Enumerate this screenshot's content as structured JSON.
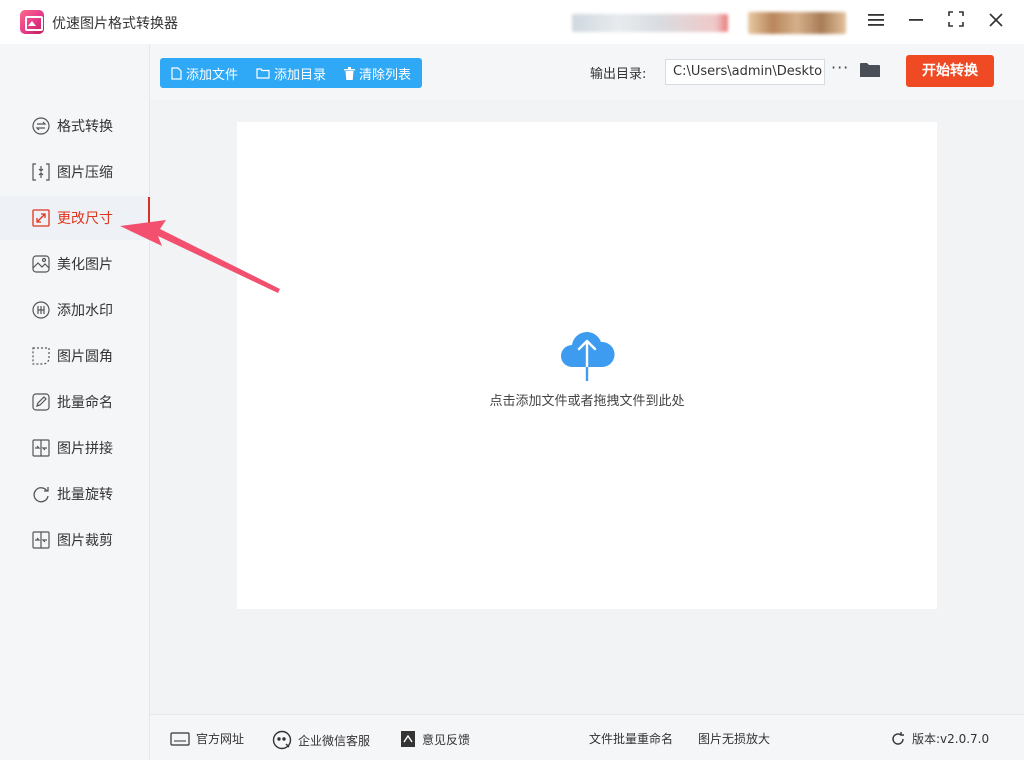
{
  "app": {
    "title": "优速图片格式转换器"
  },
  "sidebar": {
    "items": [
      {
        "label": "格式转换",
        "icon": "format-convert-icon"
      },
      {
        "label": "图片压缩",
        "icon": "compress-icon"
      },
      {
        "label": "更改尺寸",
        "icon": "resize-icon",
        "active": true
      },
      {
        "label": "美化图片",
        "icon": "beautify-icon"
      },
      {
        "label": "添加水印",
        "icon": "watermark-icon"
      },
      {
        "label": "图片圆角",
        "icon": "round-corner-icon"
      },
      {
        "label": "批量命名",
        "icon": "rename-icon"
      },
      {
        "label": "图片拼接",
        "icon": "stitch-icon"
      },
      {
        "label": "批量旋转",
        "icon": "rotate-icon"
      },
      {
        "label": "图片裁剪",
        "icon": "crop-icon"
      }
    ]
  },
  "toolbar": {
    "add_file": "添加文件",
    "add_dir": "添加目录",
    "clear_list": "清除列表",
    "output_label": "输出目录:",
    "output_path": "C:\\Users\\admin\\Deskto",
    "more": "···",
    "start": "开始转换"
  },
  "dropzone": {
    "hint": "点击添加文件或者拖拽文件到此处"
  },
  "footer": {
    "website": "官方网址",
    "wechat": "企业微信客服",
    "feedback": "意见反馈",
    "batch_rename": "文件批量重命名",
    "lossless": "图片无损放大",
    "version": "版本:v2.0.7.0"
  },
  "colors": {
    "accent": "#2fa8f5",
    "start": "#ef4a23",
    "active": "#e0351e",
    "arrow": "#f2506e"
  }
}
